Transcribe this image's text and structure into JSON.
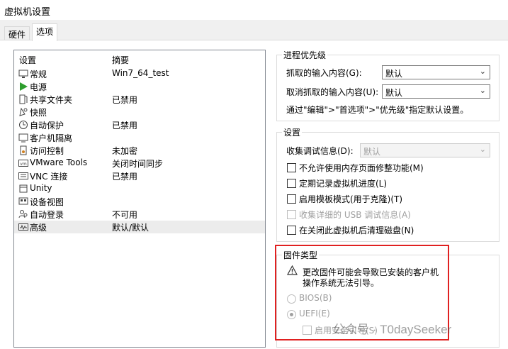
{
  "window": {
    "title": "虚拟机设置"
  },
  "tabs": [
    {
      "label": "硬件"
    },
    {
      "label": "选项"
    }
  ],
  "list": {
    "headers": {
      "setting": "设置",
      "summary": "摘要"
    },
    "items": [
      {
        "label": "常规",
        "summary": "Win7_64_test",
        "icon": "monitor-icon"
      },
      {
        "label": "电源",
        "summary": "",
        "icon": "power-icon"
      },
      {
        "label": "共享文件夹",
        "summary": "已禁用",
        "icon": "folder-icon"
      },
      {
        "label": "快照",
        "summary": "",
        "icon": "snapshot-icon"
      },
      {
        "label": "自动保护",
        "summary": "已禁用",
        "icon": "clock-icon"
      },
      {
        "label": "客户机隔离",
        "summary": "",
        "icon": "isolation-icon"
      },
      {
        "label": "访问控制",
        "summary": "未加密",
        "icon": "lock-icon"
      },
      {
        "label": "VMware Tools",
        "summary": "关闭时间同步",
        "icon": "vm-icon"
      },
      {
        "label": "VNC 连接",
        "summary": "已禁用",
        "icon": "vnc-icon"
      },
      {
        "label": "Unity",
        "summary": "",
        "icon": "unity-icon"
      },
      {
        "label": "设备视图",
        "summary": "",
        "icon": "device-view-icon"
      },
      {
        "label": "自动登录",
        "summary": "不可用",
        "icon": "users-icon"
      },
      {
        "label": "高级",
        "summary": "默认/默认",
        "icon": "pulse-icon"
      }
    ],
    "selected": "高级"
  },
  "priority": {
    "title": "进程优先级",
    "grab_label": "抓取的输入内容(G):",
    "grab_value": "默认",
    "ungrab_label": "取消抓取的输入内容(U):",
    "ungrab_value": "默认",
    "hint": "通过\"编辑\">\"首选项\">\"优先级\"指定默认设置。"
  },
  "settings": {
    "title": "设置",
    "debug_label": "收集调试信息(D):",
    "debug_value": "默认",
    "options": [
      {
        "label": "不允许使用内存页面修整功能(M)",
        "checked": false,
        "disabled": false
      },
      {
        "label": "定期记录虚拟机进度(L)",
        "checked": false,
        "disabled": false
      },
      {
        "label": "启用模板模式(用于克隆)(T)",
        "checked": false,
        "disabled": false
      },
      {
        "label": "收集详细的 USB 调试信息(A)",
        "checked": false,
        "disabled": true
      },
      {
        "label": "在关闭此虚拟机后清理磁盘(N)",
        "checked": false,
        "disabled": false
      }
    ]
  },
  "firmware": {
    "title": "固件类型",
    "warning_line1": "更改固件可能会导致已安装的客户机",
    "warning_line2": "操作系统无法引导。",
    "bios_label": "BIOS(B)",
    "uefi_label": "UEFI(E)",
    "selected": "UEFI",
    "secure_boot_label": "启用安全引导(S)"
  },
  "watermark": "公众号 · T0daySeeker",
  "colors": {
    "highlight": "#e02020",
    "power_green": "#2e9e2e"
  }
}
